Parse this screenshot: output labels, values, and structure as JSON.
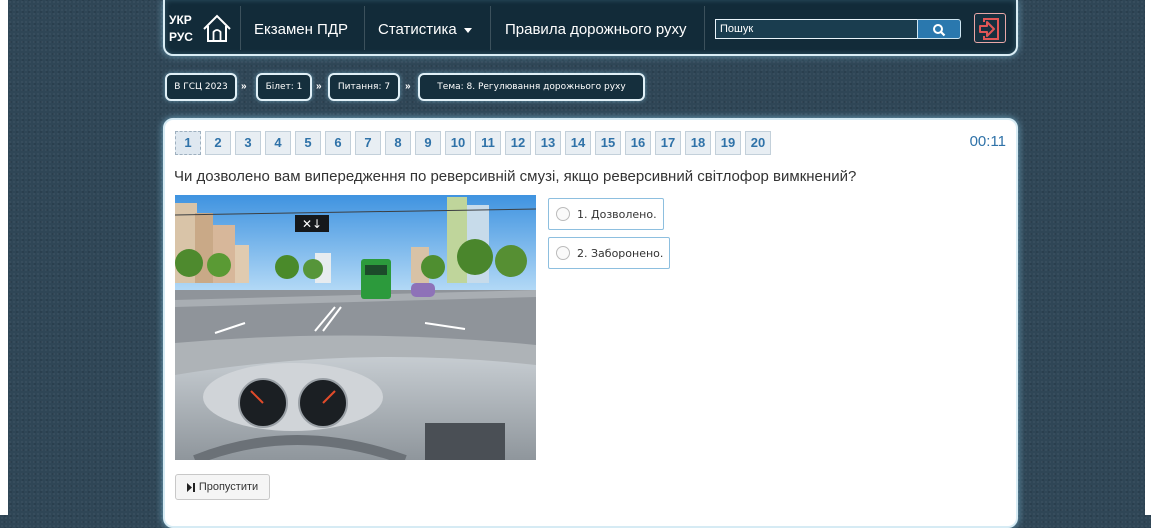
{
  "nav": {
    "lang_ukr": "УКР",
    "lang_rus": "РУС",
    "exam_label": "Екзамен ПДР",
    "stats_label": "Статистика",
    "rules_label": "Правила дорожнього руху",
    "search_placeholder": "Пошук"
  },
  "breadcrumbs": {
    "exam": "В ГСЦ 2023",
    "ticket": "Білет: 1",
    "question": "Питання: 7",
    "topic": "Тема: 8. Регулювання дорожнього руху",
    "separator": "»"
  },
  "quiz": {
    "question_numbers": [
      "1",
      "2",
      "3",
      "4",
      "5",
      "6",
      "7",
      "8",
      "9",
      "10",
      "11",
      "12",
      "13",
      "14",
      "15",
      "16",
      "17",
      "18",
      "19",
      "20"
    ],
    "active_question": "1",
    "timer": "00:11",
    "question_text": "Чи дозволено вам випередження по реверсивній смузі, якщо реверсивний світлофор вимкнений?",
    "answers": [
      "1. Дозволено.",
      "2. Заборонено."
    ],
    "skip_label": "Пропустити"
  },
  "colors": {
    "background": "#2f4656",
    "navbar": "#122b39",
    "accent_blue": "#2f72a8",
    "search_button": "#2a78ae",
    "logout_icon": "#e05656"
  },
  "icons": {
    "home": "home-icon",
    "search": "search-icon",
    "logout": "logout-icon",
    "skip": "skip-forward-icon"
  }
}
